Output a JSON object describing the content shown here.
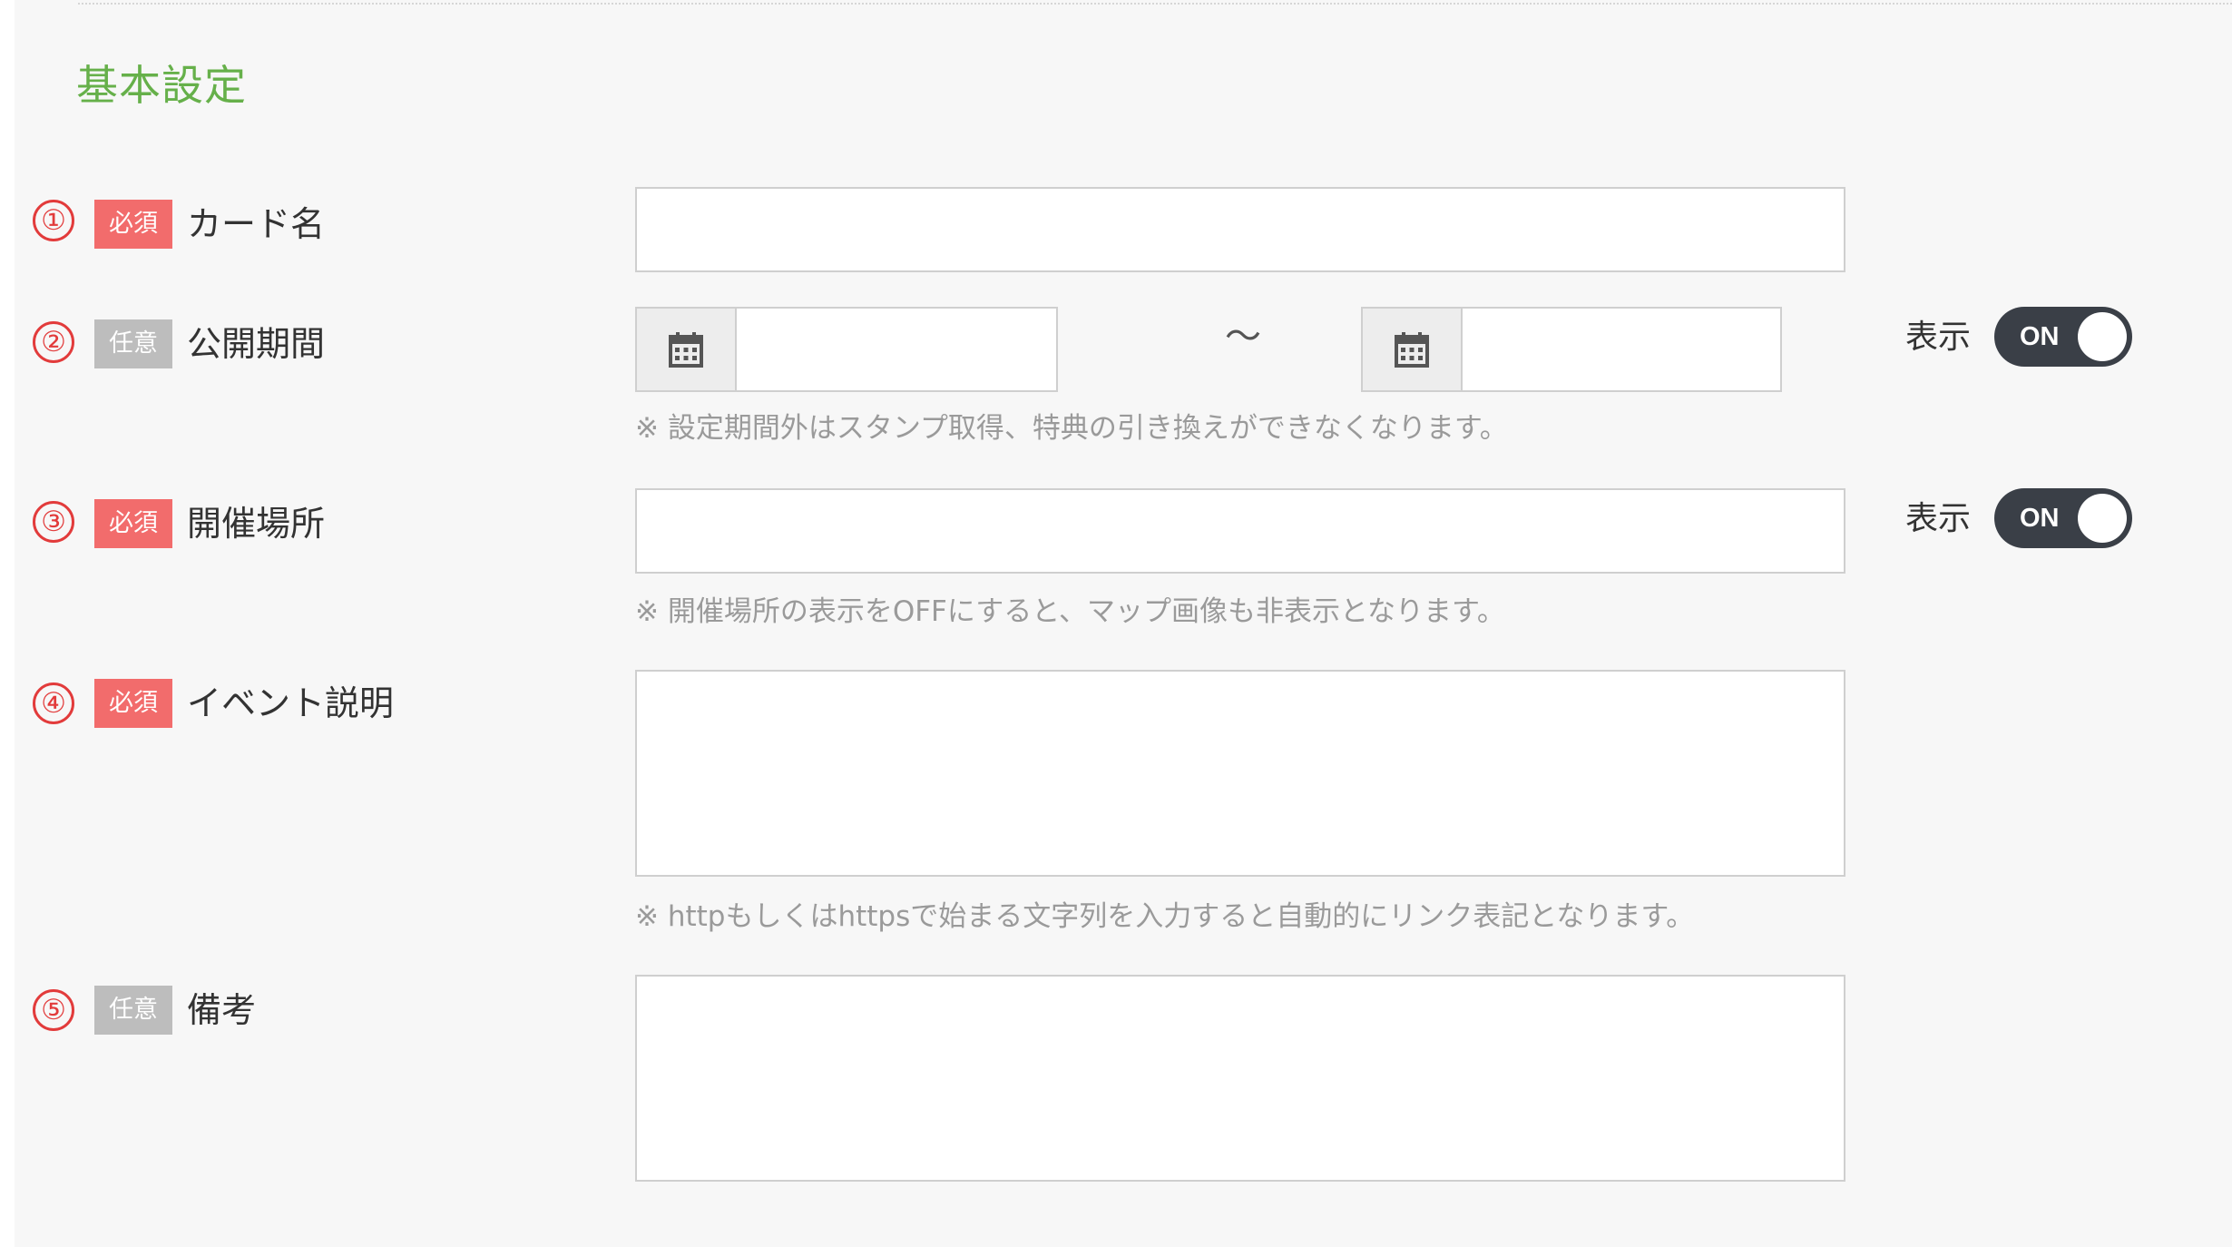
{
  "section": {
    "title": "基本設定"
  },
  "fields": [
    {
      "number": "①",
      "badge": "必須",
      "label": "カード名"
    },
    {
      "number": "②",
      "badge": "任意",
      "label": "公開期間",
      "separator": "～",
      "note": "※ 設定期間外はスタンプ取得、特典の引き換えができなくなります。",
      "display_label": "表示",
      "toggle": "ON"
    },
    {
      "number": "③",
      "badge": "必須",
      "label": "開催場所",
      "note": "※ 開催場所の表示をOFFにすると、マップ画像も非表示となります。",
      "display_label": "表示",
      "toggle": "ON"
    },
    {
      "number": "④",
      "badge": "必須",
      "label": "イベント説明",
      "note": "※ httpもしくはhttpsで始まる文字列を入力すると自動的にリンク表記となります。"
    },
    {
      "number": "⑤",
      "badge": "任意",
      "label": "備考"
    }
  ],
  "colors": {
    "section_title": "#66b04a",
    "required_badge": "#f26c6c",
    "optional_badge": "#bdbdbd",
    "number_circle": "#e23b3b",
    "toggle_bg": "#3a3f47"
  },
  "icons": {
    "date_picker": "calendar-icon"
  }
}
